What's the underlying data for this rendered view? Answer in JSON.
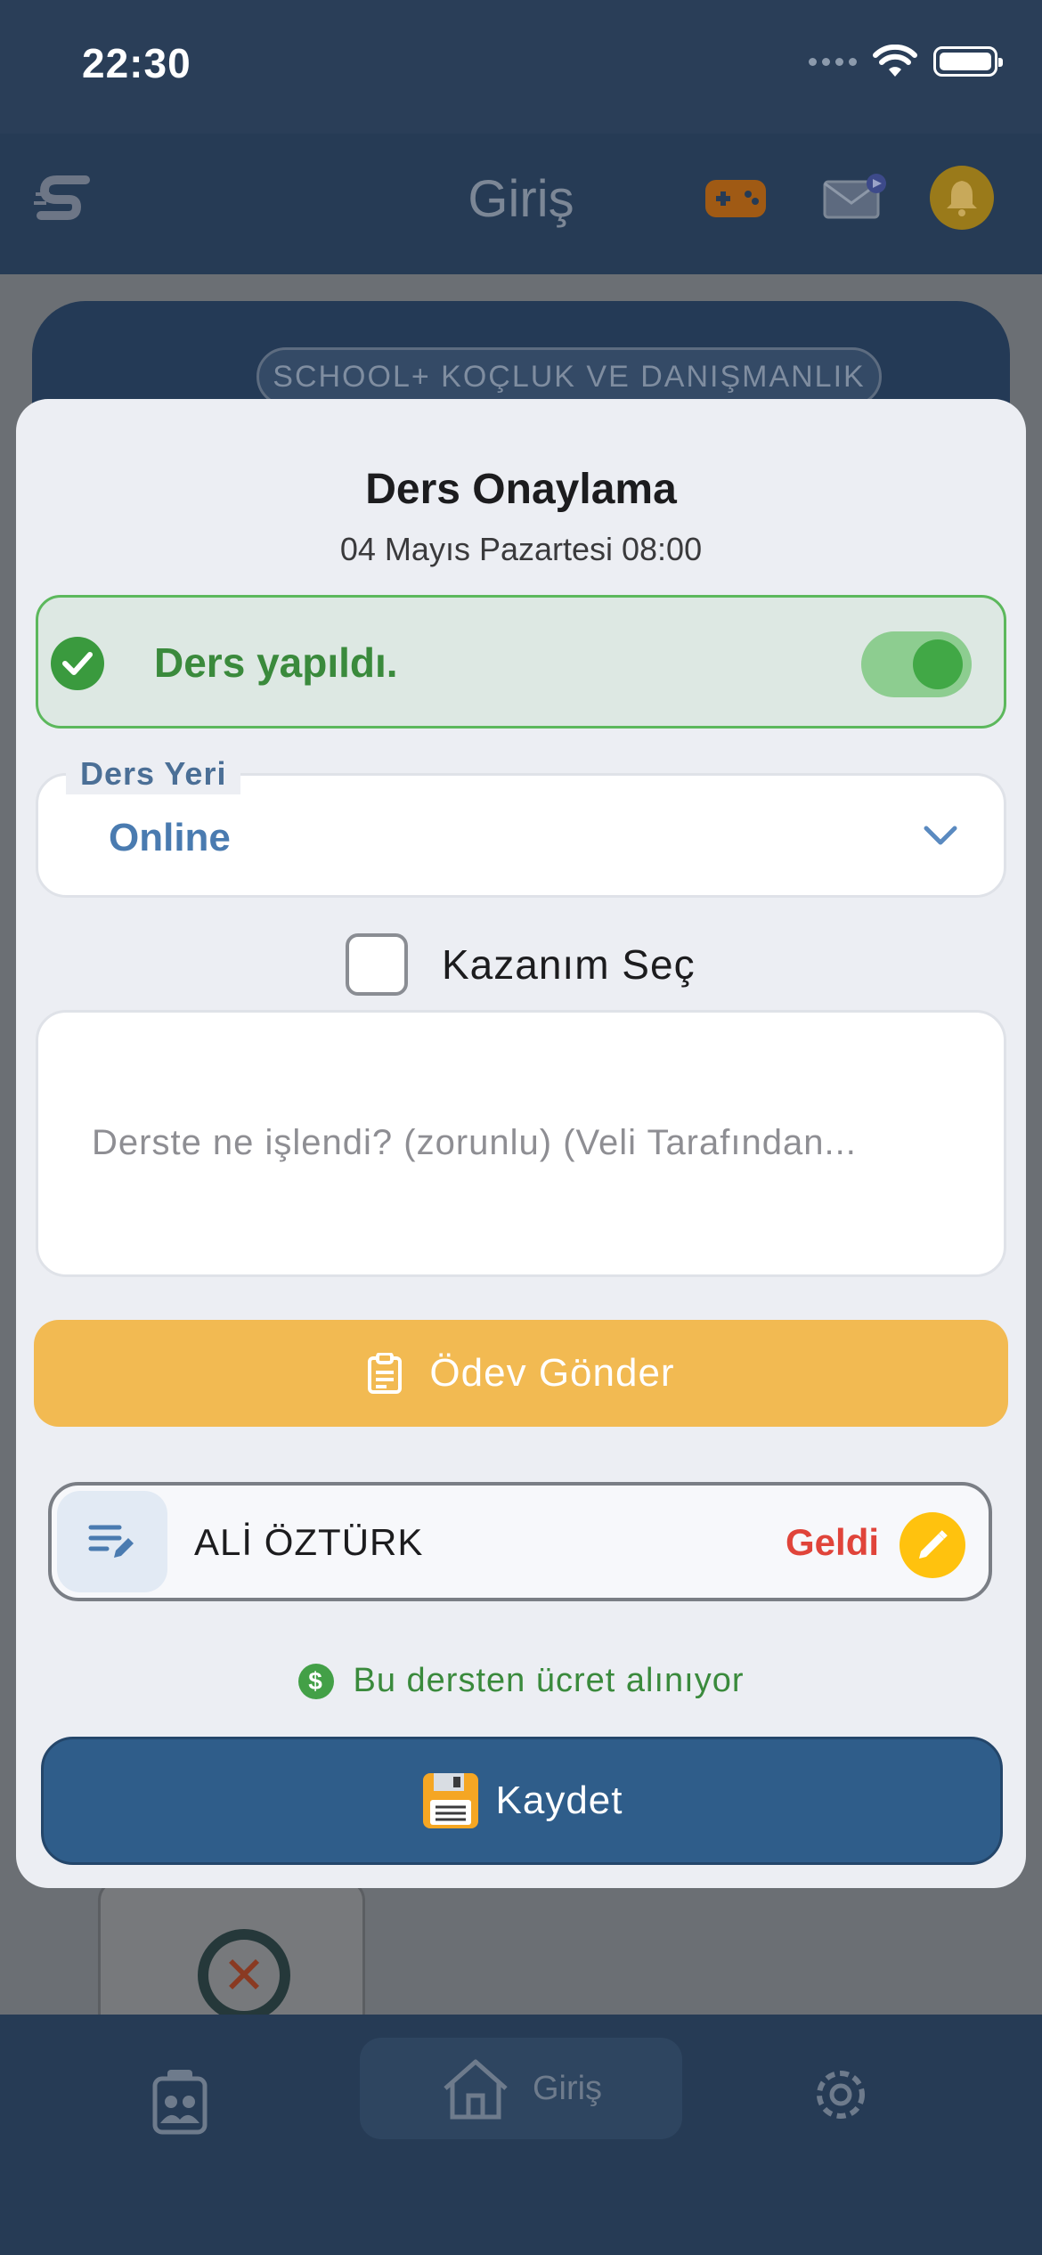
{
  "status_bar": {
    "time": "22:30"
  },
  "app_bar": {
    "title": "Giriş"
  },
  "background": {
    "card_pill": "SCHOOL+ KOÇLUK VE DANIŞMANLIK"
  },
  "bottom_nav": {
    "home_label": "Giriş"
  },
  "modal": {
    "title": "Ders Onaylama",
    "subtitle": "04 Mayıs Pazartesi 08:00",
    "done_label": "Ders yapıldı.",
    "done_toggle_on": true,
    "place_field": {
      "label": "Ders Yeri",
      "value": "Online"
    },
    "kazanim_label": "Kazanım Seç",
    "notes_placeholder": "Derste ne işlendi? (zorunlu) (Veli Tarafından...",
    "homework_button": "Ödev Gönder",
    "student": {
      "name": "ALİ ÖZTÜRK",
      "status": "Geldi"
    },
    "fee_text": "Bu dersten ücret alınıyor",
    "save_button": "Kaydet"
  },
  "colors": {
    "success": "#3a8a3c",
    "warning_button": "#f2ba52",
    "primary_button": "#2f5d8a",
    "status_red": "#e0443a"
  }
}
